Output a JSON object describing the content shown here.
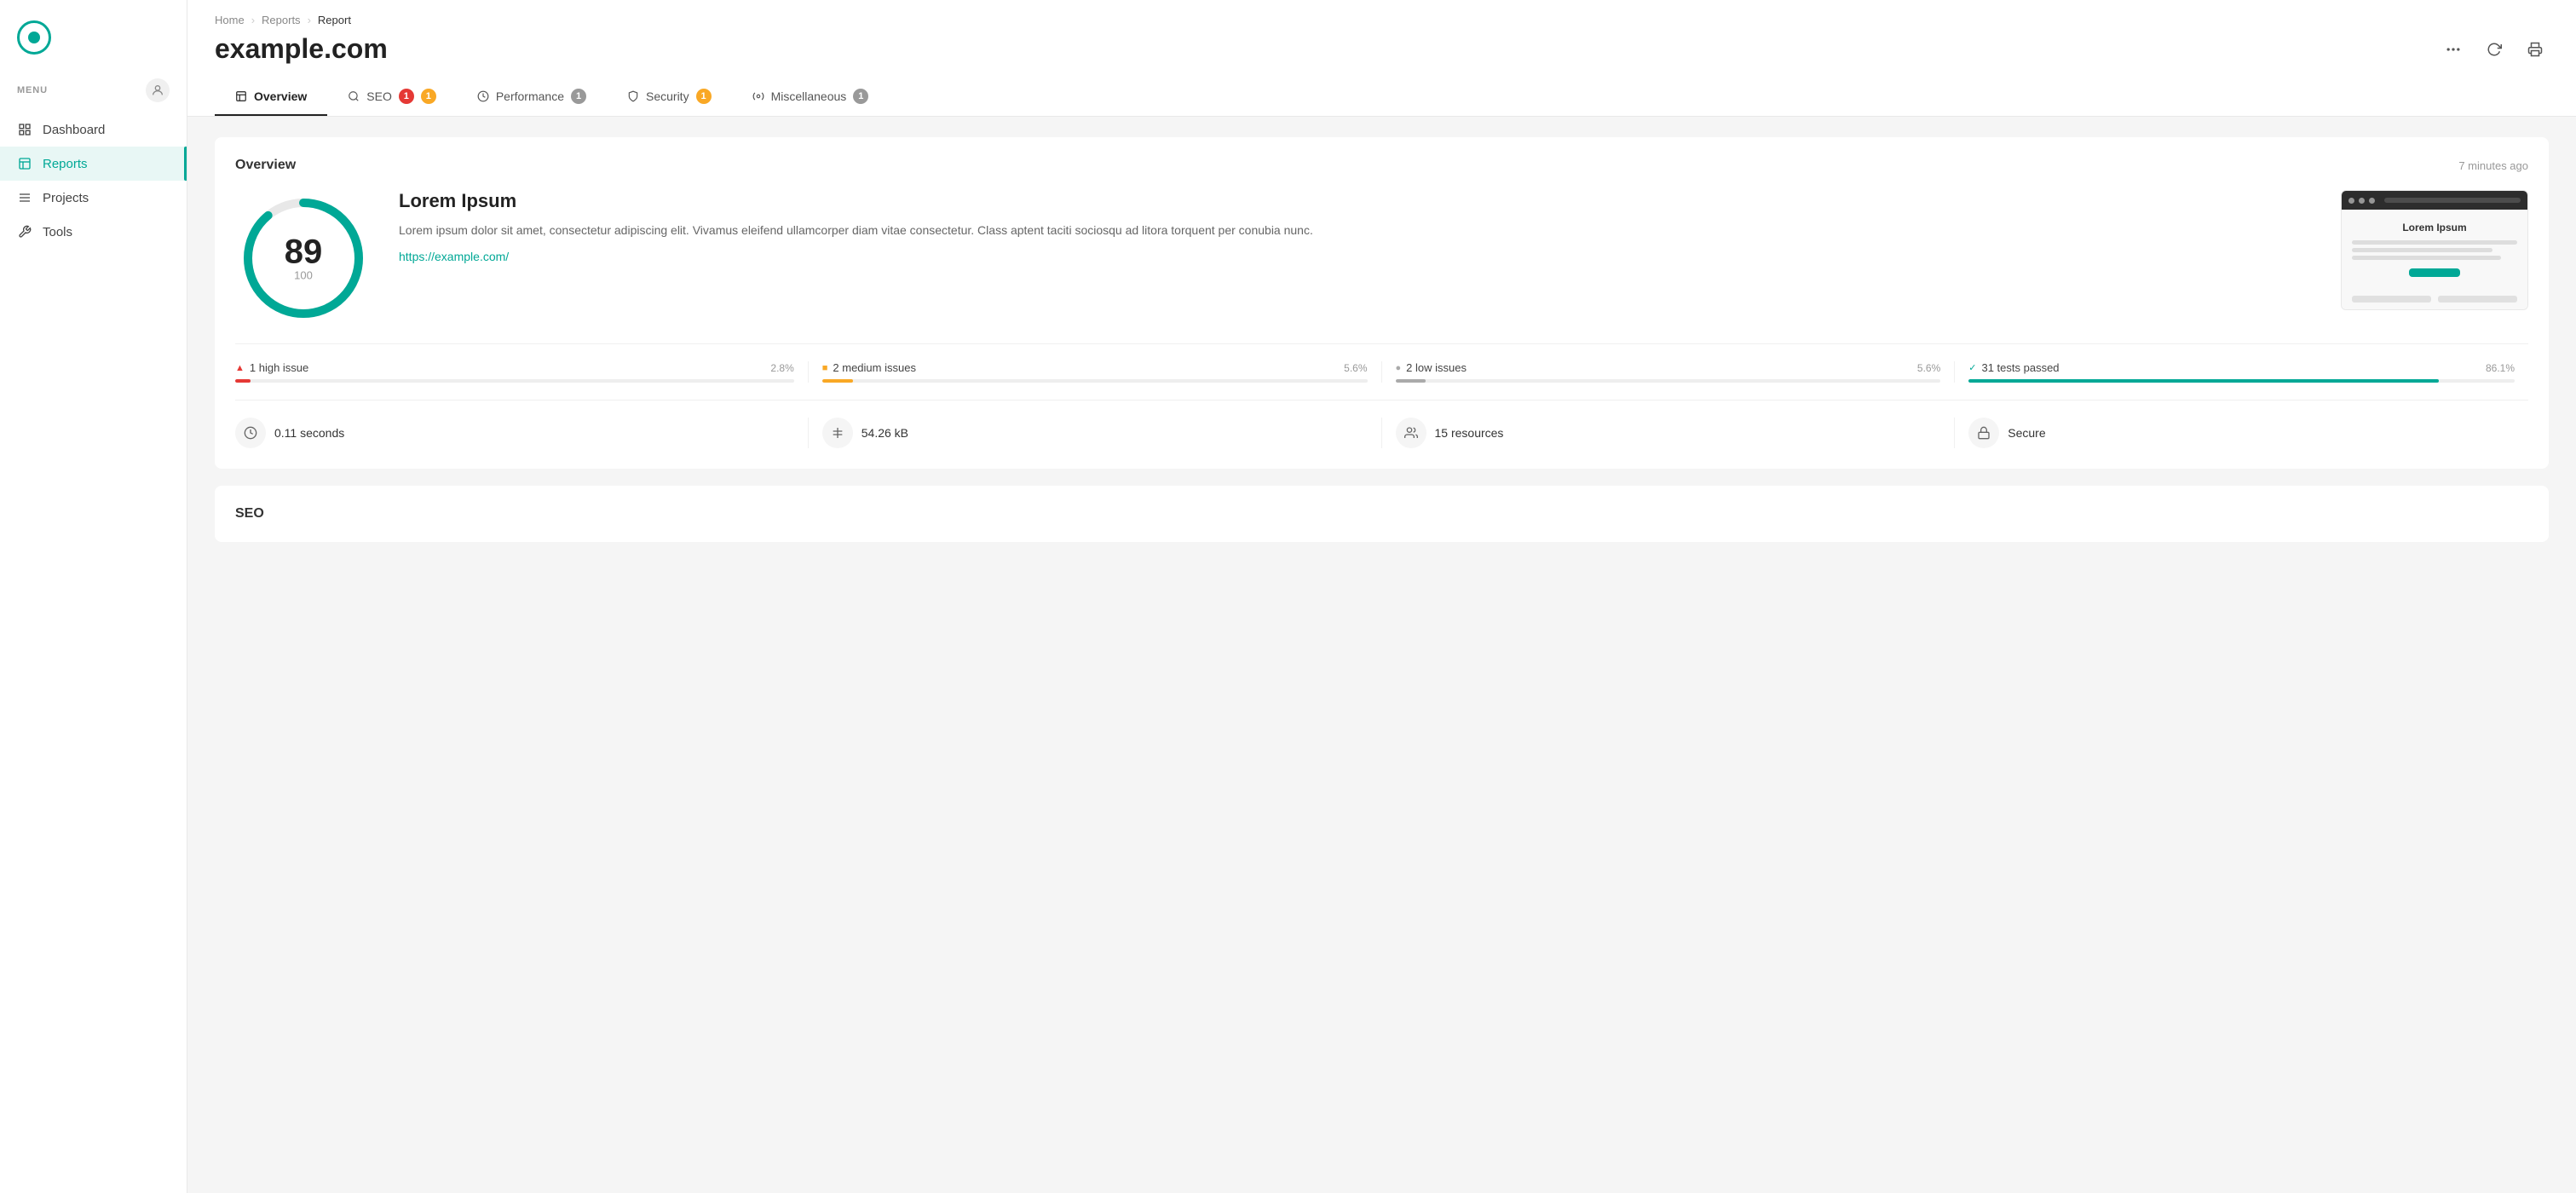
{
  "sidebar": {
    "menu_label": "MENU",
    "nav_items": [
      {
        "id": "dashboard",
        "label": "Dashboard",
        "active": false
      },
      {
        "id": "reports",
        "label": "Reports",
        "active": true
      },
      {
        "id": "projects",
        "label": "Projects",
        "active": false
      },
      {
        "id": "tools",
        "label": "Tools",
        "active": false
      }
    ]
  },
  "breadcrumb": {
    "home": "Home",
    "reports": "Reports",
    "current": "Report"
  },
  "page": {
    "title": "example.com"
  },
  "tabs": [
    {
      "id": "overview",
      "label": "Overview",
      "active": true,
      "badge": null
    },
    {
      "id": "seo",
      "label": "SEO",
      "active": false,
      "badge_red": "1",
      "badge_yellow": "1"
    },
    {
      "id": "performance",
      "label": "Performance",
      "active": false,
      "badge_gray": "1"
    },
    {
      "id": "security",
      "label": "Security",
      "active": false,
      "badge_yellow": "1"
    },
    {
      "id": "miscellaneous",
      "label": "Miscellaneous",
      "active": false,
      "badge_gray": "1"
    }
  ],
  "overview": {
    "title": "Overview",
    "timestamp": "7 minutes ago",
    "score": {
      "value": "89",
      "total": "100",
      "percent": 89
    },
    "site": {
      "name": "Lorem Ipsum",
      "description": "Lorem ipsum dolor sit amet, consectetur adipiscing elit. Vivamus eleifend ullamcorper diam vitae consectetur. Class aptent taciti sociosqu ad litora torquent per conubia nunc.",
      "url": "https://example.com/"
    },
    "preview": {
      "title": "Lorem Ipsum",
      "button_label": ""
    },
    "issues": [
      {
        "id": "high",
        "label": "1 high issue",
        "pct": "2.8%",
        "fill": 2.8,
        "color": "#e53935",
        "dot": "▲"
      },
      {
        "id": "medium",
        "label": "2 medium issues",
        "pct": "5.6%",
        "fill": 5.6,
        "color": "#f9a825",
        "dot": "■"
      },
      {
        "id": "low",
        "label": "2 low issues",
        "pct": "5.6%",
        "fill": 5.6,
        "color": "#aaa",
        "dot": "●"
      },
      {
        "id": "passed",
        "label": "31 tests passed",
        "pct": "86.1%",
        "fill": 86.1,
        "color": "#00a896",
        "dot": "✓"
      }
    ],
    "stats": [
      {
        "id": "time",
        "icon": "⏱",
        "value": "0.11 seconds"
      },
      {
        "id": "size",
        "icon": "⚖",
        "value": "54.26 kB"
      },
      {
        "id": "resources",
        "icon": "👥",
        "value": "15 resources"
      },
      {
        "id": "secure",
        "icon": "🔒",
        "value": "Secure"
      }
    ]
  },
  "seo": {
    "title": "SEO"
  }
}
